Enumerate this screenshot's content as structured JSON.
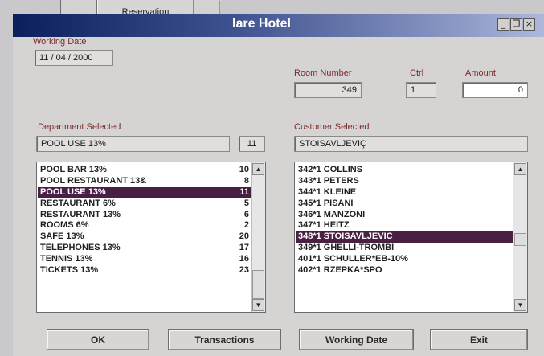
{
  "back_window": {
    "button_label": "Reservation"
  },
  "window": {
    "title": "lare Hotel",
    "controls": {
      "minimize": "_",
      "restore": "❐",
      "close": "×"
    }
  },
  "working_date": {
    "label": "Working Date",
    "value": "11 / 04 / 2000"
  },
  "room_number": {
    "label": "Room Number",
    "value": "349"
  },
  "ctrl": {
    "label": "Ctrl",
    "value": "1"
  },
  "amount": {
    "label": "Amount",
    "value": "0"
  },
  "department": {
    "label": "Department Selected",
    "selected_name": "POOL USE 13%",
    "selected_code": "11",
    "items": [
      {
        "name": "POOL BAR 13%",
        "code": "10"
      },
      {
        "name": "POOL RESTAURANT 13&",
        "code": "8"
      },
      {
        "name": "POOL USE 13%",
        "code": "11"
      },
      {
        "name": "RESTAURANT 6%",
        "code": "5"
      },
      {
        "name": "RESTAURANT 13%",
        "code": "6"
      },
      {
        "name": "ROOMS 6%",
        "code": "2"
      },
      {
        "name": "SAFE 13%",
        "code": "20"
      },
      {
        "name": "TELEPHONES 13%",
        "code": "17"
      },
      {
        "name": "TENNIS 13%",
        "code": "16"
      },
      {
        "name": "TICKETS 13%",
        "code": "23"
      }
    ],
    "selected_index": 2
  },
  "customer": {
    "label": "Customer Selected",
    "selected_name": "STOISAVLJEVIÇ",
    "items": [
      "342*1 COLLINS",
      "343*1 PETERS",
      "344*1 KLEINE",
      "345*1 PISANI",
      "346*1 MANZONI",
      "347*1 HEITZ",
      "348*1 STOISAVLJEVIC",
      "349*1 GHELLI-TROMBI",
      "401*1 SCHULLER*EB-10%",
      "402*1 RZEPKA*SPO"
    ],
    "selected_index": 6
  },
  "scroll_icons": {
    "up": "▲",
    "down": "▼"
  },
  "buttons": {
    "ok": "OK",
    "transactions": "Transactions",
    "working_date": "Working Date",
    "exit": "Exit"
  }
}
